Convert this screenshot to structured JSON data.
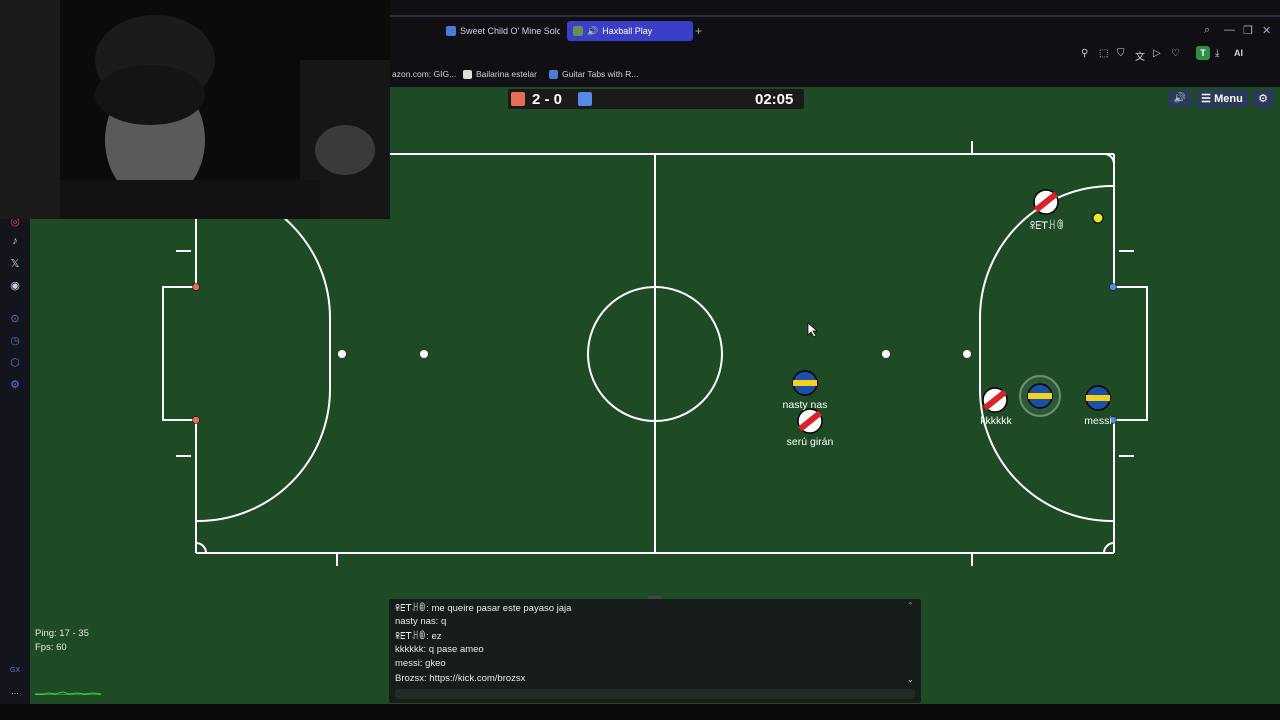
{
  "browser": {
    "tabs": [
      {
        "label": "Sweet Child O' Mine Solo",
        "active": false
      },
      {
        "label": "Haxball Play",
        "active": true
      }
    ],
    "new_tab_glyph": "+",
    "bookmarks": [
      {
        "label": "azon.com: GIG..."
      },
      {
        "label": "Bailarina estelar"
      },
      {
        "label": "Guitar Tabs with R..."
      }
    ],
    "extension_letter": "T",
    "ai_label": "AI"
  },
  "game": {
    "score": "2 - 0",
    "timer": "02:05",
    "menu_label": "Menu",
    "red_color": "#e56e56",
    "blue_color": "#5689e5",
    "pitch_color": "#1e4b26",
    "players": [
      {
        "name": "ꕉꗋꓔꃅꂦ",
        "team": "red"
      },
      {
        "name": "nasty nas",
        "team": "blue"
      },
      {
        "name": "serú girán",
        "team": "red"
      },
      {
        "name": "kkkkkk",
        "team": "red"
      },
      {
        "name": "messi",
        "team": "blue"
      },
      {
        "name": "",
        "team": "blue"
      }
    ]
  },
  "chat": {
    "messages": [
      "ꕉꗋꓔꃅꂦ: me queire pasar este payaso jaja",
      "nasty nas: q",
      "ꕉꗋꓔꃅꂦ: ez",
      "kkkkkk: q pase ameo",
      "messi: gkeo",
      "Brozsx: https://kick.com/brozsx"
    ]
  },
  "stats": {
    "ping": "Ping: 17 - 35",
    "fps": "Fps: 60"
  },
  "sidebar": {
    "icons": [
      "instagram-icon",
      "tiktok-icon",
      "x-icon",
      "discord-icon",
      "play-icon",
      "clock-icon",
      "cube-icon",
      "gear-icon"
    ],
    "gx_label": "GX",
    "more_label": "..."
  }
}
